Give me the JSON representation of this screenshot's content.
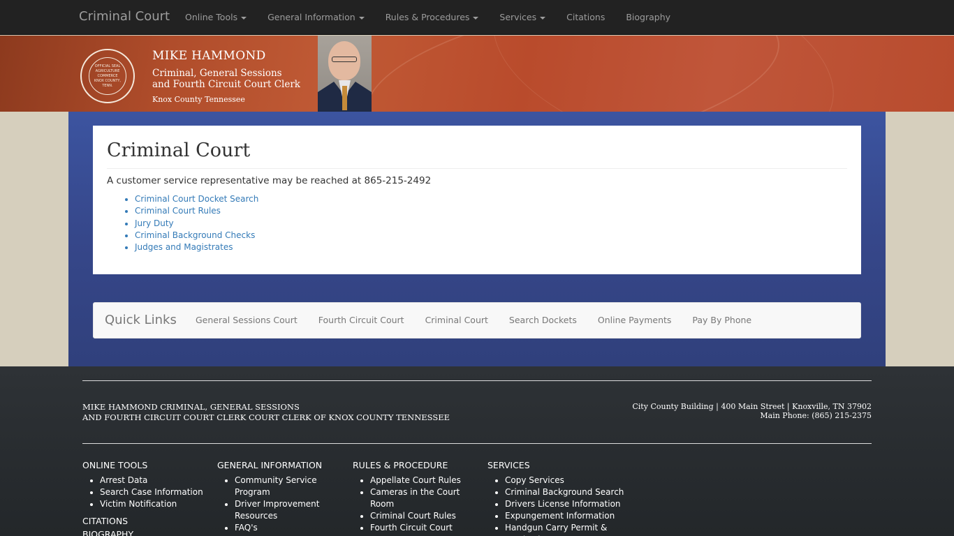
{
  "navbar": {
    "brand": "Criminal Court",
    "items": [
      {
        "label": "Online Tools",
        "dropdown": true
      },
      {
        "label": "General Information",
        "dropdown": true
      },
      {
        "label": "Rules & Procedures",
        "dropdown": true
      },
      {
        "label": "Services",
        "dropdown": true
      },
      {
        "label": "Citations",
        "dropdown": false
      },
      {
        "label": "Biography",
        "dropdown": false
      }
    ]
  },
  "header": {
    "seal_top": "OFFICIAL SEAL",
    "seal_mid1": "AGRICULTURE",
    "seal_mid2": "COMMERCE",
    "seal_bottom": "KNOX COUNTY, TENN.",
    "name": "MIKE HAMMOND",
    "title_line1": "Criminal, General Sessions",
    "title_line2": "and Fourth Circuit Court Clerk",
    "county": "Knox County Tennessee"
  },
  "main": {
    "heading": "Criminal Court",
    "service_text": "A customer service representative may be reached at 865-215-2492",
    "links": [
      "Criminal Court Docket Search",
      "Criminal Court Rules",
      "Jury Duty",
      "Criminal Background Checks",
      "Judges and Magistrates"
    ]
  },
  "quick_links": {
    "title": "Quick Links",
    "items": [
      "General Sessions Court",
      "Fourth Circuit Court",
      "Criminal Court",
      "Search Dockets",
      "Online Payments",
      "Pay By Phone"
    ]
  },
  "footer": {
    "office_line1": "MIKE HAMMOND CRIMINAL, GENERAL SESSIONS",
    "office_line2": "AND FOURTH CIRCUIT COURT CLERK COURT CLERK OF KNOX COUNTY TENNESSEE",
    "address": "City County Building | 400 Main Street | Knoxville, TN 37902",
    "phone": "Main Phone: (865) 215-2375",
    "columns": [
      {
        "heading": "ONLINE TOOLS",
        "items": [
          "Arrest Data",
          "Search Case Information",
          "Victim Notification"
        ],
        "extra": [
          "CITATIONS",
          "BIOGRAPHY"
        ]
      },
      {
        "heading": "GENERAL INFORMATION",
        "items": [
          "Community Service Program",
          "Driver Improvement Resources",
          "FAQ's"
        ]
      },
      {
        "heading": "RULES & PROCEDURE",
        "items": [
          "Appellate Court Rules",
          "Cameras in the Court Room",
          "Criminal Court Rules",
          "Fourth Circuit Court"
        ]
      },
      {
        "heading": "SERVICES",
        "items": [
          "Copy Services",
          "Criminal Background Search",
          "Drivers License Information",
          "Expungement Information",
          "Handgun Carry Permit & Purchasing"
        ]
      }
    ]
  }
}
